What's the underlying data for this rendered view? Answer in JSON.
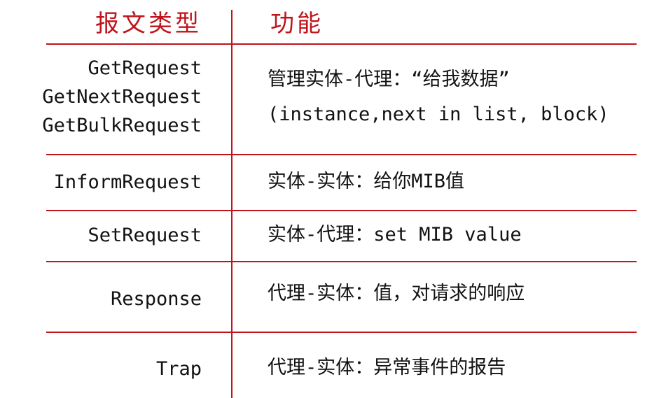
{
  "header": {
    "type_label": "报文类型",
    "function_label": "功能"
  },
  "rows": [
    {
      "type": [
        "GetRequest",
        "GetNextRequest",
        "GetBulkRequest"
      ],
      "function": [
        "管理实体-代理：“给我数据”",
        "(instance,next in list, block)"
      ]
    },
    {
      "type": [
        "InformRequest"
      ],
      "function": [
        "实体-实体：给你MIB值"
      ]
    },
    {
      "type": [
        "SetRequest"
      ],
      "function": [
        "实体-代理：set MIB value"
      ]
    },
    {
      "type": [
        "Response"
      ],
      "function": [
        "代理-实体：值，对请求的响应"
      ]
    },
    {
      "type": [
        "Trap"
      ],
      "function": [
        "代理-实体：异常事件的报告"
      ]
    }
  ],
  "colors": {
    "accent": "#c0141c",
    "text": "#111111"
  }
}
